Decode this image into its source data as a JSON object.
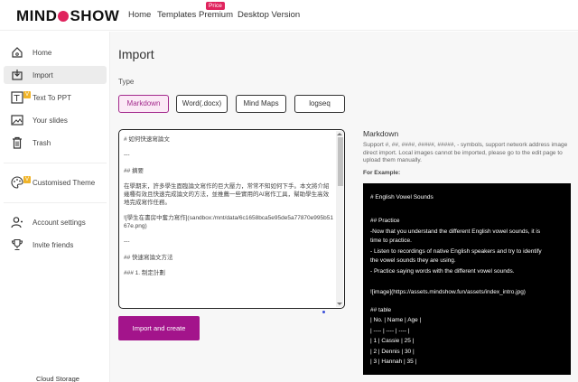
{
  "header": {
    "logo": "MINDSHOW",
    "nav": [
      "Home",
      "Templates",
      "Premium",
      "Desktop Version"
    ],
    "premium_badge": "Price"
  },
  "sidebar": {
    "items": [
      {
        "label": "Home",
        "icon": "home-icon"
      },
      {
        "label": "Import",
        "icon": "import-icon",
        "active": true
      },
      {
        "label": "Text To PPT",
        "icon": "text-to-ppt-icon",
        "badge": "V"
      },
      {
        "label": "Your slides",
        "icon": "slides-icon"
      },
      {
        "label": "Trash",
        "icon": "trash-icon"
      },
      {
        "label": "Customised Theme",
        "icon": "palette-icon",
        "badge": "V"
      },
      {
        "label": "Account settings",
        "icon": "account-icon"
      },
      {
        "label": "Invite friends",
        "icon": "trophy-icon"
      }
    ],
    "cloud_storage": "Cloud Storage"
  },
  "main": {
    "title": "Import",
    "type_label": "Type",
    "types": [
      "Markdown",
      "Word(.docx)",
      "Mind Maps",
      "logseq"
    ],
    "selected_type": "Markdown",
    "editor_value": "# 如何快速寫論文\n\n---\n\n## 摘要\n\n在學期末，許多學生面臨論文寫作的巨大壓力，常常不知如何下手。本文將介紹幾種有效且快速完成論文的方法，並推薦一些實用的AI寫作工具，幫助學生高效地完成寫作任務。\n\n![學生在書房中奮力寫作](sandbox:/mnt/data/6c1658bca5e95de5a77870e995b5167e.png)\n\n---\n\n## 快速寫論文方法\n\n### 1. 制定計劃",
    "create_button": "Import and create"
  },
  "help": {
    "title": "Markdown",
    "description": "Support #, ##, ####, #####, #####, - symbols, support network address image direct import. Local images cannot be imported, please go to the edit page to upload them manually.",
    "example_label": "For Example:",
    "example_lines": [
      "# English Vowel Sounds",
      "## Practice",
      "-Now that you understand the different English vowel sounds, it is",
      "time to practice.",
      "- Listen to recordings of native English speakers and try to identify",
      "the vowel sounds they are using.",
      "- Practice saying words with the different vowel sounds.",
      "![image](https://assets.mindshow.fun/assets/index_intro.jpg)",
      "## table",
      "| No. | Name | Age |",
      "| ---- | ---- | ---- |",
      "| 1 | Cassie | 25 |",
      "| 2 | Dennis | 30 |",
      "| 3 | Hannah | 35 |"
    ]
  },
  "colors": {
    "accent": "#a3148b",
    "brand_pink": "#e0245e",
    "selected_bg": "#fbe9f6"
  }
}
